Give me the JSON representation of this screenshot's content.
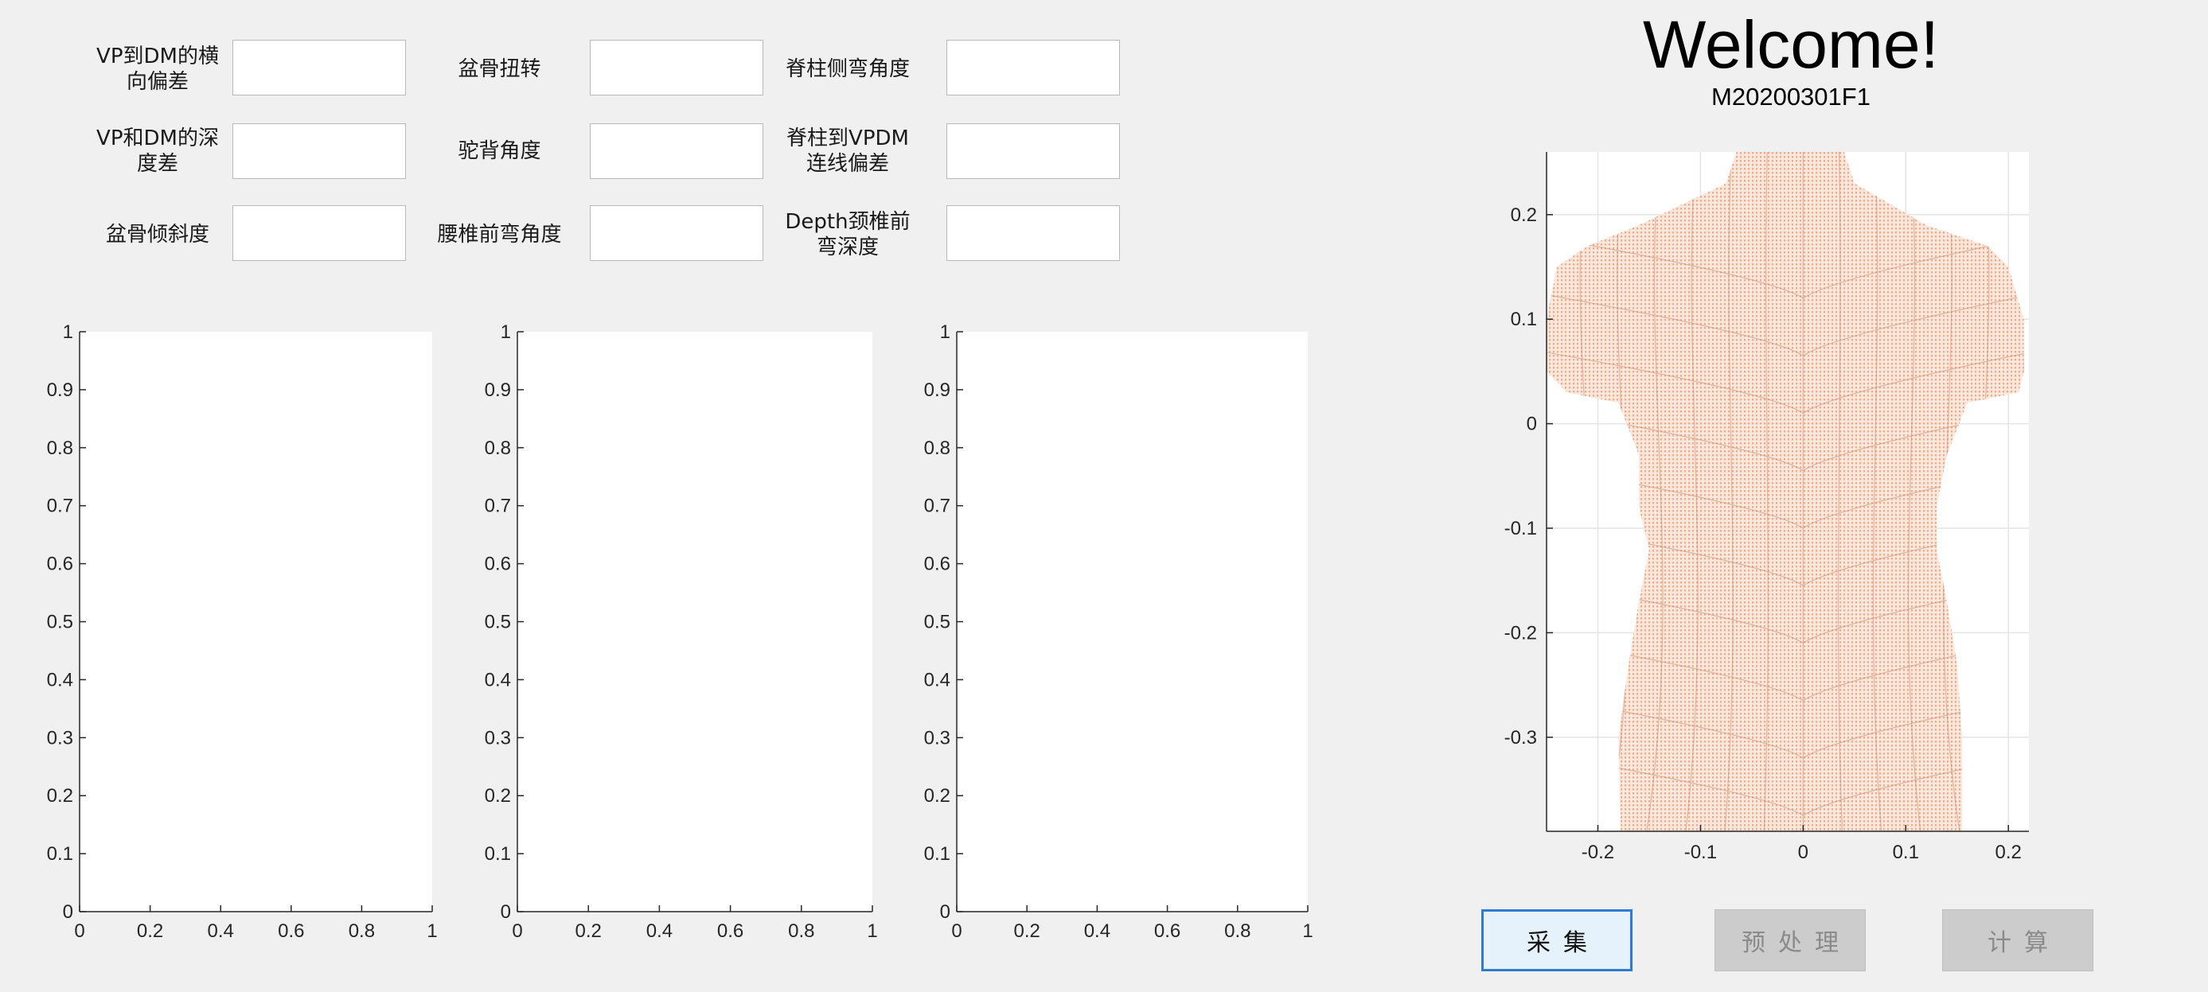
{
  "header": {
    "welcome": "Welcome!",
    "code": "M20200301F1"
  },
  "metrics": [
    {
      "label": "VP到DM的横\n向偏差",
      "value": ""
    },
    {
      "label": "盆骨扭转",
      "value": ""
    },
    {
      "label": "脊柱侧弯角度",
      "value": ""
    },
    {
      "label": "VP和DM的深\n度差",
      "value": ""
    },
    {
      "label": "驼背角度",
      "value": ""
    },
    {
      "label": "脊柱到VPDM\n连线偏差",
      "value": ""
    },
    {
      "label": "盆骨倾斜度",
      "value": ""
    },
    {
      "label": "腰椎前弯角度",
      "value": ""
    },
    {
      "label": "Depth颈椎前\n弯深度",
      "value": ""
    }
  ],
  "empty_axes": {
    "xticks": [
      "0",
      "0.2",
      "0.4",
      "0.6",
      "0.8",
      "1"
    ],
    "yticks": [
      "0",
      "0.1",
      "0.2",
      "0.3",
      "0.4",
      "0.5",
      "0.6",
      "0.7",
      "0.8",
      "0.9",
      "1"
    ]
  },
  "chart_data": {
    "type": "scatter",
    "title": "",
    "xlabel": "",
    "ylabel": "",
    "xlim": [
      -0.25,
      0.22
    ],
    "ylim": [
      -0.39,
      0.26
    ],
    "xticks": [
      "-0.2",
      "-0.1",
      "0",
      "0.1",
      "0.2"
    ],
    "yticks": [
      "0.2",
      "0.1",
      "0",
      "-0.1",
      "-0.2",
      "-0.3"
    ],
    "grid": true,
    "point_color": "#f2a07c",
    "outline": {
      "y": [
        0.26,
        0.23,
        0.19,
        0.17,
        0.15,
        0.1,
        0.05,
        0.03,
        0.02,
        -0.03,
        -0.08,
        -0.12,
        -0.17,
        -0.23,
        -0.3,
        -0.39
      ],
      "left": [
        -0.065,
        -0.075,
        -0.16,
        -0.21,
        -0.24,
        -0.25,
        -0.25,
        -0.23,
        -0.18,
        -0.16,
        -0.16,
        -0.15,
        -0.16,
        -0.17,
        -0.18,
        -0.178
      ],
      "right": [
        0.04,
        0.05,
        0.12,
        0.18,
        0.2,
        0.215,
        0.215,
        0.21,
        0.16,
        0.14,
        0.13,
        0.13,
        0.14,
        0.15,
        0.155,
        0.155
      ]
    }
  },
  "buttons": {
    "collect": "采集",
    "preprocess": "预处理",
    "compute": "计算"
  }
}
